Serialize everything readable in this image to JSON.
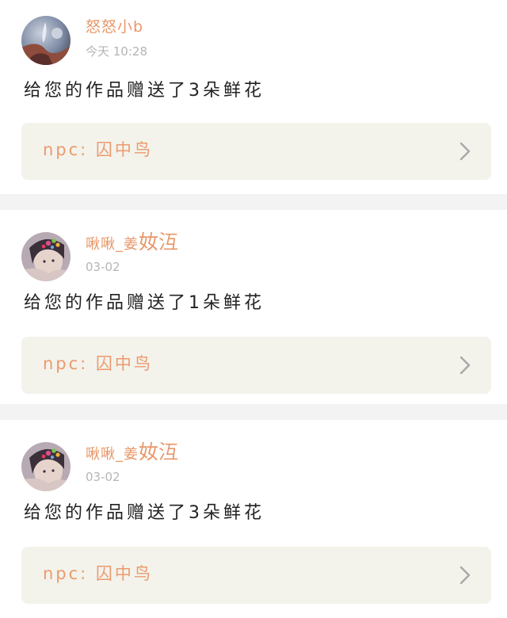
{
  "colors": {
    "accent": "#e8976a",
    "link_bg": "#f3f3ec",
    "muted": "#b5b5b5",
    "divider": "#f3f3f3"
  },
  "notifications": [
    {
      "username_main": "怒怒小b",
      "username_extra": "",
      "time": "今天 10:28",
      "message": "给您的作品赠送了3朵鲜花",
      "work_label": "npc: 囚中鸟",
      "chevron_icon": "chevron-right-icon"
    },
    {
      "username_main": "啾啾_姜",
      "username_extra": "奻沍",
      "time": "03-02",
      "message": "给您的作品赠送了1朵鲜花",
      "work_label": "npc: 囚中鸟",
      "chevron_icon": "chevron-right-icon"
    },
    {
      "username_main": "啾啾_姜",
      "username_extra": "奻沍",
      "time": "03-02",
      "message": "给您的作品赠送了3朵鲜花",
      "work_label": "npc: 囚中鸟",
      "chevron_icon": "chevron-right-icon"
    }
  ]
}
